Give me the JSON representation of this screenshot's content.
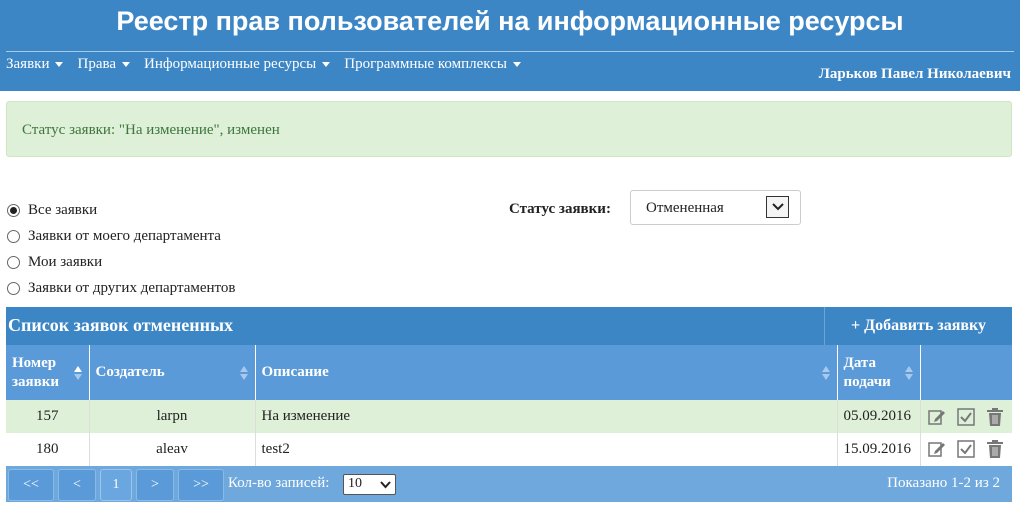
{
  "header": {
    "title": "Реестр прав пользователей на информационные ресурсы",
    "user": "Ларьков Павел Николаевич",
    "nav": [
      {
        "label": "Заявки"
      },
      {
        "label": "Права"
      },
      {
        "label": "Информационные ресурсы"
      },
      {
        "label": "Программные комплексы"
      }
    ]
  },
  "alert": {
    "text": "Статус заявки: \"На изменение\", изменен"
  },
  "filters": {
    "options": [
      {
        "label": "Все заявки",
        "checked": true
      },
      {
        "label": "Заявки от моего департамента",
        "checked": false
      },
      {
        "label": "Мои заявки",
        "checked": false
      },
      {
        "label": "Заявки от других департаментов",
        "checked": false
      }
    ],
    "status_label": "Статус заявки:",
    "status_value": "Отмененная"
  },
  "panel": {
    "title": "Список заявок отмененных",
    "add_button": "+ Добавить заявку"
  },
  "table": {
    "columns": [
      "Номер заявки",
      "Создатель",
      "Описание",
      "Дата подачи"
    ],
    "rows": [
      {
        "number": "157",
        "creator": "larpn",
        "description": "На изменение",
        "date": "05.09.2016"
      },
      {
        "number": "180",
        "creator": "aleav",
        "description": "test2",
        "date": "15.09.2016"
      }
    ]
  },
  "pagination": {
    "first": "<<",
    "prev": "<",
    "current": "1",
    "next": ">",
    "last": ">>",
    "per_page_label": "Кол-во записей:",
    "per_page_value": "10",
    "shown": "Показано 1-2 из 2"
  },
  "colors": {
    "primary": "#3d86c6",
    "header_row": "#5b9ad8",
    "alert_bg": "#dff0d8",
    "alert_text": "#3c763d"
  }
}
